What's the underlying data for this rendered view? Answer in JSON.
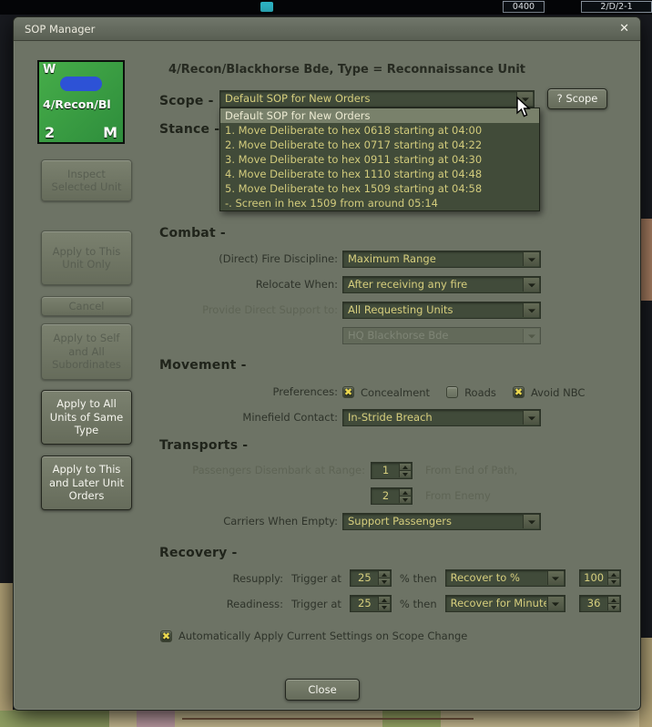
{
  "backdrop": {
    "clock": "0400",
    "unit_ref": "2/D/2-1"
  },
  "window": {
    "title": "SOP Manager",
    "close_glyph": "✕"
  },
  "header": {
    "title": "4/Recon/Blackhorse Bde, Type = Reconnaissance Unit"
  },
  "unit_counter": {
    "corner_tl": "W",
    "name": "4/Recon/Bl",
    "corner_bl": "2",
    "corner_br": "M"
  },
  "side_buttons": [
    {
      "label": "Inspect Selected Unit",
      "enabled": false
    },
    {
      "label": "Apply to This Unit Only",
      "enabled": false
    },
    {
      "label": "Cancel",
      "enabled": false
    },
    {
      "label": "Apply to Self and All Subordinates",
      "enabled": false
    },
    {
      "label": "Apply to All Units of Same Type",
      "enabled": true
    },
    {
      "label": "Apply to This and Later Unit Orders",
      "enabled": true
    }
  ],
  "scope": {
    "label": "Scope -",
    "selected": "Default SOP for New Orders",
    "help_button": "? Scope",
    "options": [
      "Default SOP for New Orders",
      "1. Move Deliberate to hex 0618 starting at 04:00",
      "2. Move Deliberate to hex 0717 starting at 04:22",
      "3. Move Deliberate to hex 0911 starting at 04:30",
      "4. Move Deliberate to hex 1110 starting at 04:48",
      "5. Move Deliberate to hex 1509 starting at 04:58",
      "-. Screen in hex 1509 from around 05:14"
    ]
  },
  "stance": {
    "label": "Stance -"
  },
  "combat": {
    "heading": "Combat -",
    "fire_discipline": {
      "label": "(Direct) Fire Discipline:",
      "value": "Maximum Range"
    },
    "relocate_when": {
      "label": "Relocate When:",
      "value": "After receiving any fire"
    },
    "direct_support": {
      "label": "Provide Direct Support to:",
      "value": "All Requesting Units"
    },
    "hq": {
      "value": "HQ Blackhorse Bde"
    }
  },
  "movement": {
    "heading": "Movement -",
    "preferences_label": "Preferences:",
    "checkboxes": [
      {
        "label": "Concealment",
        "checked": true
      },
      {
        "label": "Roads",
        "checked": false
      },
      {
        "label": "Avoid NBC",
        "checked": true
      }
    ],
    "minefield": {
      "label": "Minefield Contact:",
      "value": "In-Stride Breach"
    }
  },
  "transports": {
    "heading": "Transports -",
    "disembark_label": "Passengers Disembark at Range:",
    "disembark_value": "1",
    "disembark_suffix": "From End of Path,",
    "enemy_value": "2",
    "enemy_suffix": "From Enemy",
    "carriers": {
      "label": "Carriers When Empty:",
      "value": "Support Passengers"
    }
  },
  "recovery": {
    "heading": "Recovery -",
    "resupply": {
      "label": "Resupply:",
      "trigger_label": "Trigger at",
      "trigger_value": "25",
      "then_label": "% then",
      "action": "Recover to %",
      "amount": "100"
    },
    "readiness": {
      "label": "Readiness:",
      "trigger_label": "Trigger at",
      "trigger_value": "25",
      "then_label": "% then",
      "action": "Recover for Minutes",
      "amount": "36"
    }
  },
  "auto_apply": {
    "label": "Automatically Apply Current Settings on Scope Change",
    "checked": true
  },
  "close_button": "Close",
  "colors": {
    "dialog_bg": "#6d7365",
    "combo_bg": "#414b3a",
    "combo_text": "#d6ce7d",
    "check_mark": "#ecd84e",
    "counter_green": "#3aa142",
    "vehicle_blue": "#2d52d6"
  }
}
